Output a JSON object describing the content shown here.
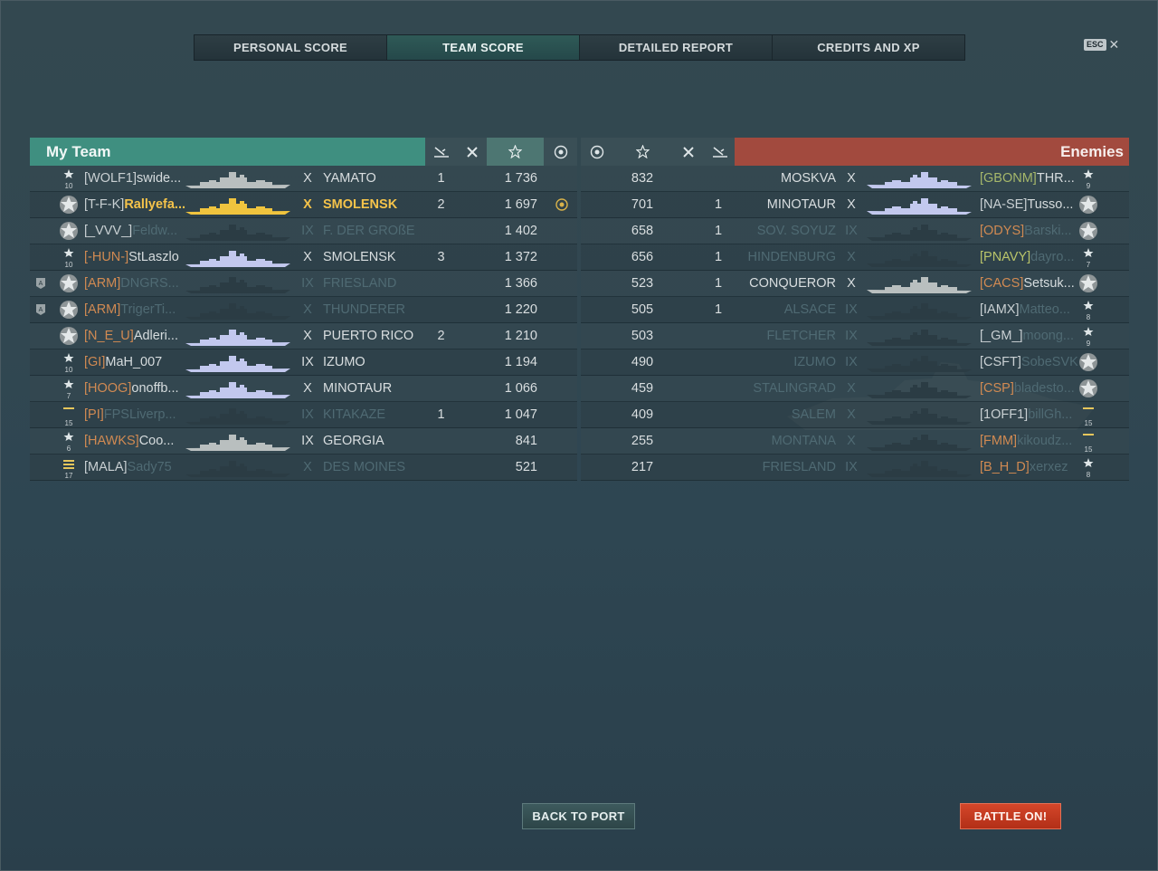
{
  "tabs": [
    {
      "label": "PERSONAL SCORE",
      "active": false
    },
    {
      "label": "TEAM SCORE",
      "active": true
    },
    {
      "label": "DETAILED REPORT",
      "active": false
    },
    {
      "label": "CREDITS AND XP",
      "active": false
    }
  ],
  "close": {
    "key": "ESC",
    "icon": "close-icon"
  },
  "my_team": {
    "title": "My Team",
    "columns": [
      "planes-destroyed-icon",
      "ships-destroyed-icon",
      "xp-star-icon",
      "base-capture-icon"
    ],
    "rows": [
      {
        "clan": "[WOLF1]",
        "clan_color": "white",
        "name": "swide...",
        "tier": "X",
        "ship": "YAMATO",
        "planes": "1",
        "xp": "1 736",
        "base": "",
        "rank": "10",
        "badge": "",
        "alive": true,
        "me": false
      },
      {
        "clan": "[T-F-K]",
        "clan_color": "white",
        "name": "Rallyefa...",
        "tier": "X",
        "ship": "SMOLENSK",
        "planes": "2",
        "xp": "1 697",
        "base": "cap",
        "rank": "",
        "badge": "",
        "alive": true,
        "me": true
      },
      {
        "clan": "[_VVV_]",
        "clan_color": "white",
        "name": "Feldw...",
        "tier": "IX",
        "ship": "F. DER GROßE",
        "planes": "",
        "xp": "1 402",
        "base": "",
        "rank": "",
        "badge": "",
        "alive": false,
        "me": false
      },
      {
        "clan": "[-HUN-]",
        "clan_color": "orange",
        "name": "StLaszlo",
        "tier": "X",
        "ship": "SMOLENSK",
        "planes": "3",
        "xp": "1 372",
        "base": "",
        "rank": "10",
        "badge": "",
        "alive": true,
        "me": false
      },
      {
        "clan": "[ARM]",
        "clan_color": "orange",
        "name": "DNGRS...",
        "tier": "IX",
        "ship": "FRIESLAND",
        "planes": "",
        "xp": "1 366",
        "base": "",
        "rank": "",
        "badge": "A",
        "alive": false,
        "me": false
      },
      {
        "clan": "[ARM]",
        "clan_color": "orange",
        "name": "TrigerTi...",
        "tier": "X",
        "ship": "THUNDERER",
        "planes": "",
        "xp": "1 220",
        "base": "",
        "rank": "",
        "badge": "A",
        "alive": false,
        "me": false
      },
      {
        "clan": "[N_E_U]",
        "clan_color": "orange",
        "name": "Adleri...",
        "tier": "X",
        "ship": "PUERTO RICO",
        "planes": "2",
        "xp": "1 210",
        "base": "",
        "rank": "",
        "badge": "",
        "alive": true,
        "me": false
      },
      {
        "clan": "[GI]",
        "clan_color": "orange",
        "name": "MaH_007",
        "tier": "IX",
        "ship": "IZUMO",
        "planes": "",
        "xp": "1 194",
        "base": "",
        "rank": "10",
        "badge": "",
        "alive": true,
        "me": false
      },
      {
        "clan": "[HOOG]",
        "clan_color": "orange",
        "name": "onoffb...",
        "tier": "X",
        "ship": "MINOTAUR",
        "planes": "",
        "xp": "1 066",
        "base": "",
        "rank": "7",
        "badge": "",
        "alive": true,
        "me": false
      },
      {
        "clan": "[PI]",
        "clan_color": "orange",
        "name": "FPSLiverp...",
        "tier": "IX",
        "ship": "KITAKAZE",
        "planes": "1",
        "xp": "1 047",
        "base": "",
        "rank": "15",
        "badge": "",
        "alive": false,
        "me": false
      },
      {
        "clan": "[HAWKS]",
        "clan_color": "orange",
        "name": "Coo...",
        "tier": "IX",
        "ship": "GEORGIA",
        "planes": "",
        "xp": "841",
        "base": "",
        "rank": "6",
        "badge": "",
        "alive": true,
        "me": false
      },
      {
        "clan": "[MALA]",
        "clan_color": "white",
        "name": "Sady75",
        "tier": "X",
        "ship": "DES MOINES",
        "planes": "",
        "xp": "521",
        "base": "",
        "rank": "17",
        "badge": "",
        "alive": false,
        "me": false
      }
    ]
  },
  "enemies": {
    "title": "Enemies",
    "rows": [
      {
        "xp": "832",
        "frags": "",
        "ship": "MOSKVA",
        "tier": "X",
        "clan": "[GBONM]",
        "clan_color": "olive",
        "name": "THR...",
        "rank": "9",
        "alive": true
      },
      {
        "xp": "701",
        "frags": "1",
        "ship": "MINOTAUR",
        "tier": "X",
        "clan": "[NA-SE]",
        "clan_color": "white",
        "name": "Tusso...",
        "rank": "",
        "alive": true
      },
      {
        "xp": "658",
        "frags": "1",
        "ship": "SOV. SOYUZ",
        "tier": "IX",
        "clan": "[ODYS]",
        "clan_color": "orange",
        "name": "Barski...",
        "rank": "",
        "alive": false
      },
      {
        "xp": "656",
        "frags": "1",
        "ship": "HINDENBURG",
        "tier": "X",
        "clan": "[PNAVY]",
        "clan_color": "green",
        "name": "dayro...",
        "rank": "7",
        "alive": false
      },
      {
        "xp": "523",
        "frags": "1",
        "ship": "CONQUEROR",
        "tier": "X",
        "clan": "[CACS]",
        "clan_color": "orange",
        "name": "Setsuk...",
        "rank": "",
        "alive": true
      },
      {
        "xp": "505",
        "frags": "1",
        "ship": "ALSACE",
        "tier": "IX",
        "clan": "[IAMX]",
        "clan_color": "white",
        "name": "Matteo...",
        "rank": "8",
        "alive": false
      },
      {
        "xp": "503",
        "frags": "",
        "ship": "FLETCHER",
        "tier": "IX",
        "clan": "[_GM_]",
        "clan_color": "white",
        "name": "moong...",
        "rank": "9",
        "alive": false
      },
      {
        "xp": "490",
        "frags": "",
        "ship": "IZUMO",
        "tier": "IX",
        "clan": "[CSFT]",
        "clan_color": "white",
        "name": "SobeSVK",
        "rank": "",
        "alive": false
      },
      {
        "xp": "459",
        "frags": "",
        "ship": "STALINGRAD",
        "tier": "X",
        "clan": "[CSP]",
        "clan_color": "orange",
        "name": "bladesto...",
        "rank": "",
        "alive": false
      },
      {
        "xp": "409",
        "frags": "",
        "ship": "SALEM",
        "tier": "X",
        "clan": "[1OFF1]",
        "clan_color": "white",
        "name": "billGh...",
        "rank": "15",
        "alive": false
      },
      {
        "xp": "255",
        "frags": "",
        "ship": "MONTANA",
        "tier": "X",
        "clan": "[FMM]",
        "clan_color": "orange",
        "name": "kikoudz...",
        "rank": "15",
        "alive": false
      },
      {
        "xp": "217",
        "frags": "",
        "ship": "FRIESLAND",
        "tier": "IX",
        "clan": "[B_H_D]",
        "clan_color": "orange",
        "name": "xerxez",
        "rank": "8",
        "alive": false
      }
    ]
  },
  "buttons": {
    "back": "BACK TO PORT",
    "battle": "BATTLE ON!"
  },
  "colors": {
    "my_team_header": "#3f8f80",
    "enemy_header": "#a24a3e",
    "player_highlight": "#f5c34a",
    "clan_orange": "#d18a52",
    "battle_button": "#c13a20"
  }
}
